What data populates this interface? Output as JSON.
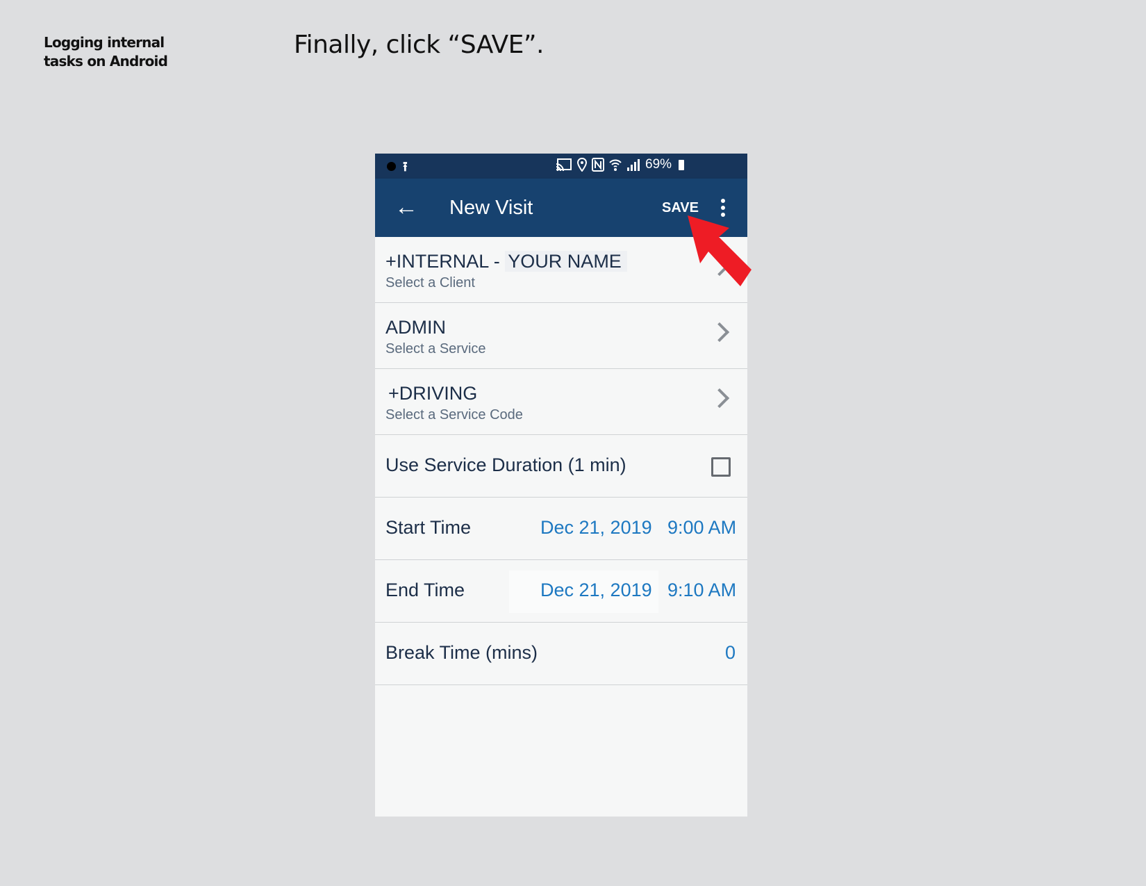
{
  "header": {
    "side_title_line1": "Logging internal",
    "side_title_line2": "tasks on Android",
    "instruction": "Finally, click “SAVE”."
  },
  "status_bar": {
    "battery": "69%",
    "icons": [
      "dot-icon",
      "upload-icon",
      "cast-icon",
      "location-icon",
      "nfc-icon",
      "wifi-icon",
      "signal-icon",
      "battery-icon"
    ]
  },
  "app_bar": {
    "back_icon": "←",
    "title": "New Visit",
    "save_label": "SAVE"
  },
  "rows": {
    "client": {
      "value_prefix": "+INTERNAL - ",
      "value_name": "YOUR NAME",
      "hint": "Select a Client"
    },
    "service": {
      "value": "ADMIN",
      "hint": "Select a Service"
    },
    "service_code": {
      "value": "+DRIVING",
      "hint": "Select a Service Code"
    },
    "duration": {
      "label": "Use Service Duration (1 min)",
      "checked": false
    },
    "start": {
      "label": "Start Time",
      "date": "Dec 21, 2019",
      "time": "9:00 AM"
    },
    "end": {
      "label": "End Time",
      "date": "Dec 21, 2019",
      "time": "9:10 AM"
    },
    "break": {
      "label": "Break Time (mins)",
      "value": "0"
    }
  },
  "colors": {
    "status_bar": "#17355b",
    "app_bar": "#17426f",
    "accent_value": "#1d78c1",
    "arrow": "#ee1c25"
  }
}
